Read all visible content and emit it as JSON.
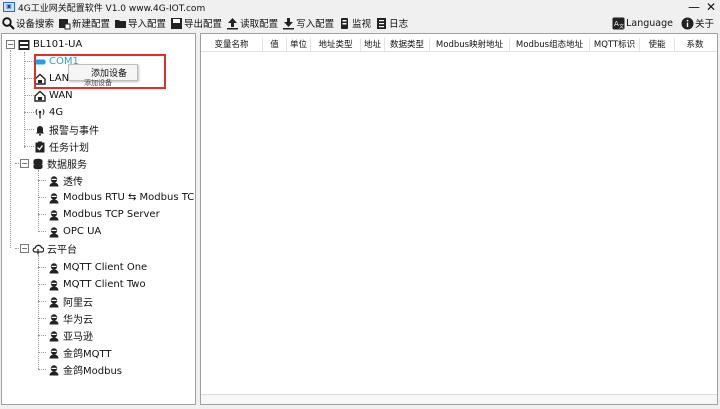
{
  "window": {
    "title": "4G工业网关配置软件 V1.0 www.4G-IOT.com",
    "minimize": "—",
    "close": "✕"
  },
  "toolbar": {
    "items": [
      {
        "label": "设备搜索",
        "icon": "search-icon"
      },
      {
        "label": "新建配置",
        "icon": "new-config-icon"
      },
      {
        "label": "导入配置",
        "icon": "folder-open-icon"
      },
      {
        "label": "导出配置",
        "icon": "save-icon"
      },
      {
        "label": "读取配置",
        "icon": "upload-icon"
      },
      {
        "label": "写入配置",
        "icon": "download-icon"
      },
      {
        "label": "监视",
        "icon": "monitor-icon"
      },
      {
        "label": "日志",
        "icon": "log-icon"
      }
    ],
    "language": "Language",
    "about": "关于"
  },
  "tree": {
    "root": "BL101-UA",
    "com1": "COM1",
    "lan": "LAN",
    "wan": "WAN",
    "g4": "4G",
    "alarm": "报警与事件",
    "task": "任务计划",
    "data_service": "数据服务",
    "ds_items": [
      "透传",
      "Modbus RTU ⇆ Modbus TCP",
      "Modbus TCP Server",
      "OPC UA"
    ],
    "cloud": "云平台",
    "cloud_items": [
      "MQTT Client One",
      "MQTT Client Two",
      "阿里云",
      "华为云",
      "亚马逊",
      "金鸽MQTT",
      "金鸽Modbus"
    ]
  },
  "context_menu": {
    "item": "添加设备",
    "tooltip": "添加设备"
  },
  "table": {
    "columns": [
      "变量名称",
      "值",
      "单位",
      "地址类型",
      "地址",
      "数据类型",
      "Modbus映射地址",
      "Modbus组态地址",
      "MQTT标识",
      "使能",
      "系数"
    ]
  },
  "colors": {
    "highlight": "#e0302a",
    "com_text": "#1fa0e8"
  }
}
